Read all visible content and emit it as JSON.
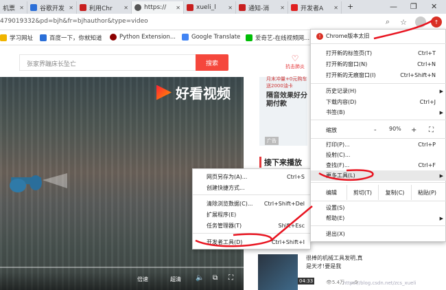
{
  "tabs": [
    {
      "title": "机票",
      "color": "#1e73be"
    },
    {
      "title": "谷歌开发",
      "color": "#2b6fd8"
    },
    {
      "title": "利用Chr",
      "color": "#c81e1e"
    },
    {
      "title": "https://",
      "color": "#555555"
    },
    {
      "title": "xueli_l",
      "color": "#c81e1e"
    },
    {
      "title": "通知-消",
      "color": "#c81e1e"
    },
    {
      "title": "开发者A",
      "color": "#e02020"
    }
  ],
  "window": {
    "new_tab": "+",
    "minimize": "—",
    "maximize": "❐",
    "close": "✕"
  },
  "address": {
    "url": "479019332&pd=bjh&fr=bjhauthor&type=video"
  },
  "bookmarks": [
    {
      "label": "学习网址",
      "color": "#f0b400"
    },
    {
      "label": "百度一下，你就知道",
      "color": "#2b6fd8"
    },
    {
      "label": "Python Extension...",
      "color": "#8b0000"
    },
    {
      "label": "Google Translate",
      "color": "#4285f4"
    },
    {
      "label": "爱奇艺-在线视频网...",
      "color": "#00be06"
    }
  ],
  "search": {
    "placeholder": "张家界蹦床长坠亡",
    "button": "搜索",
    "anti_fraud": "抗击肺炎"
  },
  "video": {
    "brand": "好看视频",
    "speed": "倍速",
    "quality": "超清",
    "progress": 0.0
  },
  "sidebar": {
    "ad_small": "月末冲量+0元购车 送2000油卡",
    "ad_text": "隔音效果好分期付款",
    "ad_label": "广告",
    "up_next": "接下来播放",
    "rec_title": "很棒的机械工具发明,真是天才!要是我",
    "rec_duration": "04:33",
    "rec_views": "5.4万",
    "rec_comments": "9",
    "rec_partial": "5.4万",
    "prev_views": "0",
    "watermark": "https://blog.csdn.net/zcs_xueli"
  },
  "menu": {
    "update": "Chrome版本太旧",
    "new_tab": {
      "label": "打开新的标签页(T)",
      "shortcut": "Ctrl+T"
    },
    "new_window": {
      "label": "打开新的窗口(N)",
      "shortcut": "Ctrl+N"
    },
    "incognito": {
      "label": "打开新的无痕窗口(I)",
      "shortcut": "Ctrl+Shift+N"
    },
    "history": {
      "label": "历史记录(H)"
    },
    "downloads": {
      "label": "下载内容(D)",
      "shortcut": "Ctrl+J"
    },
    "bookmarks": {
      "label": "书签(B)"
    },
    "zoom": {
      "label": "缩放",
      "minus": "-",
      "value": "90%",
      "plus": "+"
    },
    "print": {
      "label": "打印(P)...",
      "shortcut": "Ctrl+P"
    },
    "cast": {
      "label": "投射(C)..."
    },
    "find": {
      "label": "查找(F)...",
      "shortcut": "Ctrl+F"
    },
    "more_tools": {
      "label": "更多工具(L)"
    },
    "edit": {
      "label": "编辑",
      "cut": "剪切(T)",
      "copy": "复制(C)",
      "paste": "粘贴(P)"
    },
    "settings": {
      "label": "设置(S)"
    },
    "help": {
      "label": "帮助(E)"
    },
    "exit": {
      "label": "退出(X)"
    }
  },
  "submenu": {
    "save_as": {
      "label": "网页另存为(A)...",
      "shortcut": "Ctrl+S"
    },
    "shortcut": {
      "label": "创建快捷方式..."
    },
    "clear": {
      "label": "清除浏览数据(C)...",
      "shortcut": "Ctrl+Shift+Del"
    },
    "extensions": {
      "label": "扩展程序(E)"
    },
    "task_manager": {
      "label": "任务管理器(T)",
      "shortcut": "Shift+Esc"
    },
    "devtools": {
      "label": "开发者工具(D)",
      "shortcut": "Ctrl+Shift+I"
    }
  }
}
